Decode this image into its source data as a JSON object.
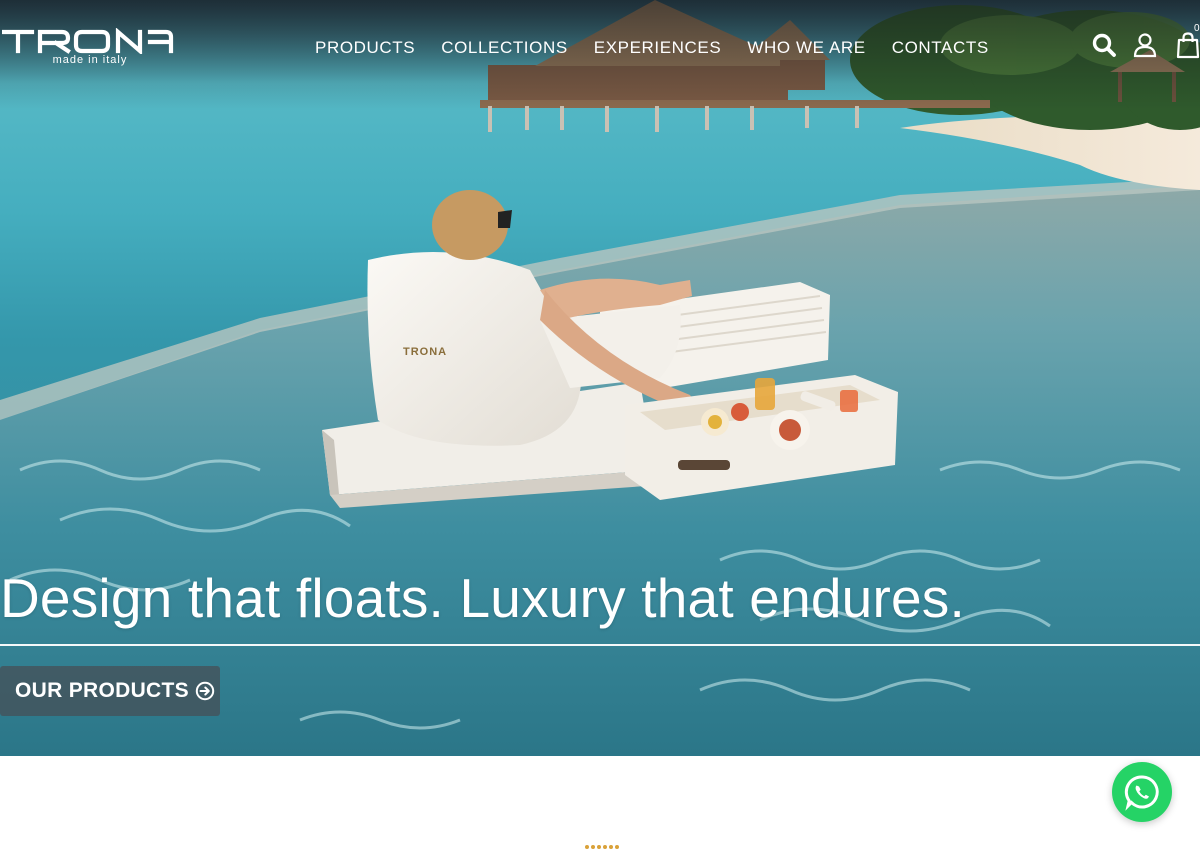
{
  "brand": {
    "name": "TRONA",
    "tagline": "made in italy"
  },
  "nav": {
    "items": [
      {
        "label": "PRODUCTS"
      },
      {
        "label": "COLLECTIONS"
      },
      {
        "label": "EXPERIENCES"
      },
      {
        "label": "WHO WE ARE"
      },
      {
        "label": "CONTACTS"
      }
    ]
  },
  "header_icons": {
    "search": "search-icon",
    "account": "user-icon",
    "cart": "shopping-bag-icon",
    "cart_count": "0"
  },
  "hero": {
    "headline": "Design that floats. Luxury that endures.",
    "cta_label": "OUR PRODUCTS",
    "cta_icon": "arrow-circle-right-icon",
    "image_description": ""
  },
  "floating": {
    "whatsapp_icon": "whatsapp-icon"
  },
  "colors": {
    "whatsapp_green": "#25d366",
    "cta_background": "#464e54",
    "loader_gold": "#d9a23a",
    "text_white": "#ffffff"
  }
}
